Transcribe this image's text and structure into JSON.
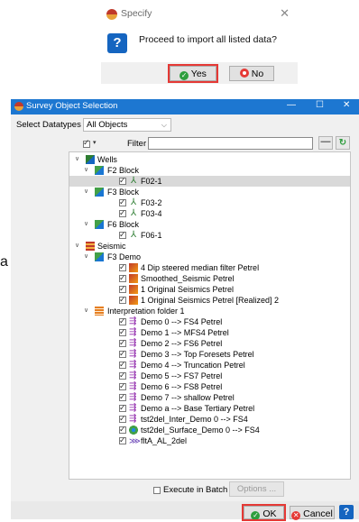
{
  "specify_dialog": {
    "title": "Specify",
    "close_glyph": "✕",
    "question_glyph": "?",
    "message": "Proceed to import all listed data?",
    "yes_label": "Yes",
    "no_label": "No"
  },
  "stray_text": "a",
  "survey_window": {
    "title": "Survey Object Selection",
    "minimize_glyph": "—",
    "maximize_glyph": "☐",
    "close_glyph": "✕",
    "datatypes_label": "Select Datatypes",
    "datatypes_value": "All Objects",
    "filter_label": "Filter",
    "filter_value": "",
    "minus_glyph": "—",
    "reload_glyph": "↻",
    "tree": {
      "wells": "Wells",
      "f2_block": "F2 Block",
      "f02_1": "F02-1",
      "f3_block": "F3 Block",
      "f03_2": "F03-2",
      "f03_4": "F03-4",
      "f6_block": "F6 Block",
      "f06_1": "F06-1",
      "seismic": "Seismic",
      "f3_demo": "F3 Demo",
      "vol1": "4 Dip steered median filter Petrel",
      "vol2": "Smoothed_Seismic Petrel",
      "vol3": "1 Original Seismics Petrel",
      "vol4": "1 Original Seismics Petrel [Realized] 2",
      "interp_folder": "Interpretation folder 1",
      "h1": "Demo 0 --> FS4 Petrel",
      "h2": "Demo 1 --> MFS4 Petrel",
      "h3": "Demo 2 --> FS6 Petrel",
      "h4": "Demo 3  --> Top Foresets Petrel",
      "h5": "Demo 4 --> Truncation Petrel",
      "h6": "Demo 5 --> FS7 Petrel",
      "h7": "Demo 6 --> FS8 Petrel",
      "h8": "Demo 7 --> shallow Petrel",
      "h9": "Demo a --> Base Tertiary Petrel",
      "h10": "tst2del_Inter_Demo 0 --> FS4",
      "h11": "tst2del_Surface_Demo 0 --> FS4",
      "h12": "fltA_AL_2del"
    },
    "execute_batch_label": "Execute in Batch",
    "options_label": "Options ...",
    "ok_label": "OK",
    "cancel_label": "Cancel",
    "help_glyph": "?"
  },
  "colors": {
    "title_bar": "#1d77d1",
    "highlight": "#e53935",
    "accent_green": "#2e9e3e"
  }
}
